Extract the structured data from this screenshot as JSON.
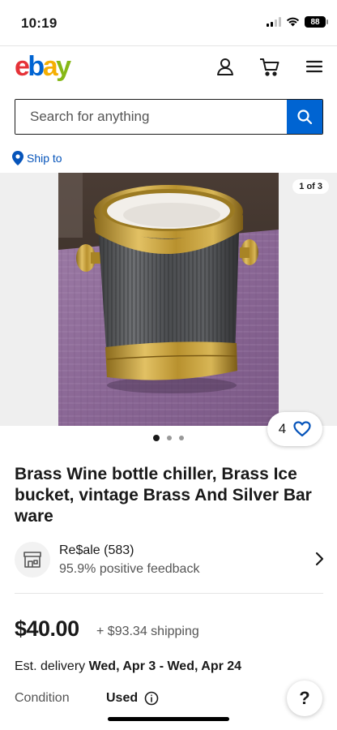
{
  "status_bar": {
    "time": "10:19",
    "battery": "88"
  },
  "header": {
    "logo": {
      "e": "e",
      "b": "b",
      "a": "a",
      "y": "y"
    },
    "icons": [
      "user-icon",
      "cart-icon",
      "menu-icon"
    ]
  },
  "search": {
    "placeholder": "Search for anything",
    "value": ""
  },
  "ship_to": {
    "label": "Ship to"
  },
  "gallery": {
    "counter": "1 of 3",
    "total_images": 3,
    "current_image": 1
  },
  "watch": {
    "count": "4"
  },
  "listing": {
    "title": "Brass Wine bottle chiller, Brass Ice bucket, vintage Brass And Silver Bar ware",
    "seller": {
      "name": "Re$ale (583)",
      "feedback": "95.9% positive feedback"
    },
    "price": "$40.00",
    "shipping": "+ $93.34 shipping",
    "delivery_label": "Est. delivery",
    "delivery_dates": "Wed, Apr 3 - Wed, Apr 24",
    "condition_label": "Condition",
    "condition_value": "Used"
  },
  "help": {
    "label": "?"
  },
  "colors": {
    "brand_blue": "#0064d2",
    "link_blue": "#0654ba",
    "text": "#191919",
    "muted": "#555555"
  }
}
